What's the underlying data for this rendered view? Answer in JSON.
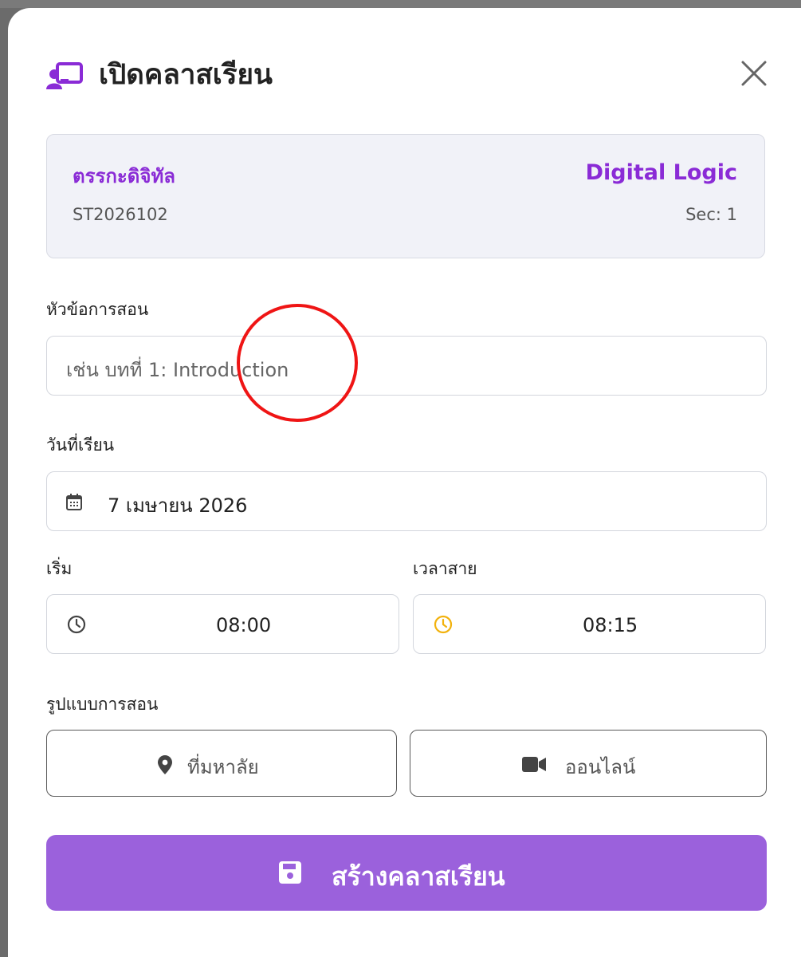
{
  "dialog": {
    "title": "เปิดคลาสเรียน"
  },
  "course": {
    "name_th": "ตรรกะดิจิทัล",
    "name_en": "Digital Logic",
    "code": "ST2026102",
    "section": "Sec: 1"
  },
  "form": {
    "topic_label": "หัวข้อการสอน",
    "topic_placeholder": "เช่น บทที่ 1: Introduction",
    "date_label": "วันที่เรียน",
    "date_value": "7 เมษายน 2026",
    "start_label": "เริ่ม",
    "start_value": "08:00",
    "late_label": "เวลาสาย",
    "late_value": "08:15",
    "mode_label": "รูปแบบการสอน",
    "mode_onsite": "ที่มหาลัย",
    "mode_online": "ออนไลน์"
  },
  "submit_label": "สร้างคลาสเรียน",
  "colors": {
    "accent": "#8a2bd6",
    "button": "#9b61dc",
    "late_clock": "#f2b20d",
    "annotation": "#ef1515"
  },
  "icons": [
    "chalkboard-teacher-icon",
    "close-icon",
    "calendar-icon",
    "clock-icon",
    "location-pin-icon",
    "video-camera-icon",
    "save-icon"
  ]
}
